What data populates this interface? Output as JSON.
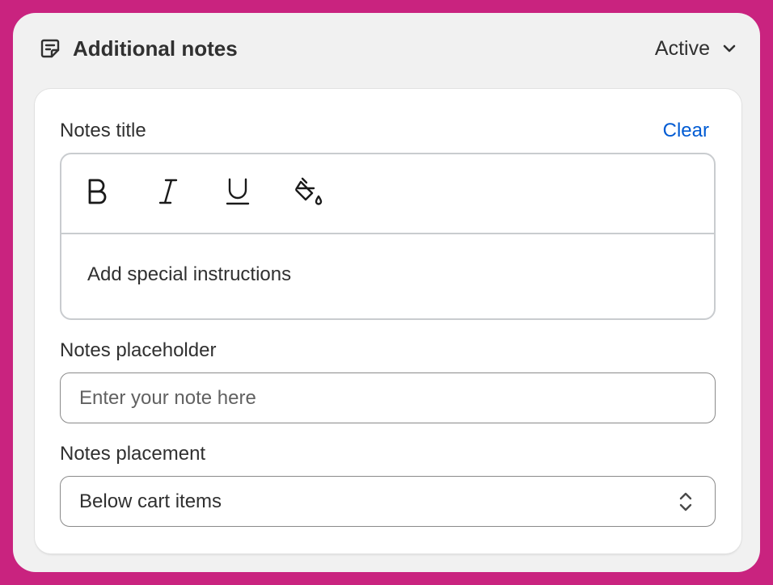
{
  "header": {
    "title": "Additional notes",
    "status": "Active",
    "icon": "note-icon"
  },
  "notes_title": {
    "label": "Notes title",
    "clear_label": "Clear",
    "toolbar": [
      "bold-icon",
      "italic-icon",
      "underline-icon",
      "fill-color-icon"
    ],
    "body_text": "Add special instructions"
  },
  "notes_placeholder": {
    "label": "Notes placeholder",
    "value": "Enter your note here"
  },
  "notes_placement": {
    "label": "Notes placement",
    "selected": "Below cart items"
  },
  "colors": {
    "background": "#c9237f",
    "panel": "#f1f1f1",
    "link": "#005bd3",
    "text": "#303030"
  }
}
